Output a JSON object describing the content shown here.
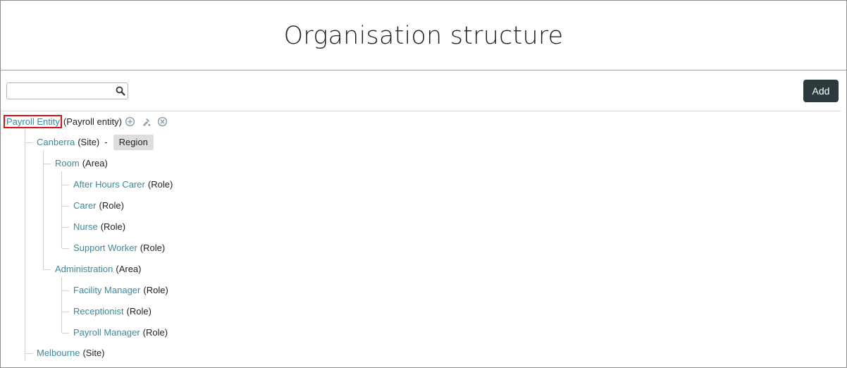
{
  "header": {
    "title": "Organisation structure"
  },
  "toolbar": {
    "search_value": "",
    "search_icon": "search-icon",
    "add_label": "Add"
  },
  "tree": {
    "root": {
      "label": "Payroll Entity",
      "type": "(Payroll entity)",
      "action_icons": [
        "add-circle-icon",
        "edit-tool-icon",
        "remove-circle-icon"
      ]
    },
    "sites": [
      {
        "label": "Canberra",
        "type": "(Site)",
        "separator": "-",
        "tag": "Region",
        "areas": [
          {
            "label": "Room",
            "type": "(Area)",
            "roles": [
              {
                "label": "After Hours Carer",
                "type": "(Role)"
              },
              {
                "label": "Carer",
                "type": "(Role)"
              },
              {
                "label": "Nurse",
                "type": "(Role)"
              },
              {
                "label": "Support Worker",
                "type": "(Role)"
              }
            ]
          },
          {
            "label": "Administration",
            "type": "(Area)",
            "roles": [
              {
                "label": "Facility Manager",
                "type": "(Role)"
              },
              {
                "label": "Receptionist",
                "type": "(Role)"
              },
              {
                "label": "Payroll Manager",
                "type": "(Role)"
              }
            ]
          }
        ]
      },
      {
        "label": "Melbourne",
        "type": "(Site)"
      }
    ]
  },
  "colors": {
    "link": "#3a8a9f",
    "button_bg": "#2c3a3d",
    "highlight_border": "#e01010",
    "tag_bg": "#dedede"
  }
}
